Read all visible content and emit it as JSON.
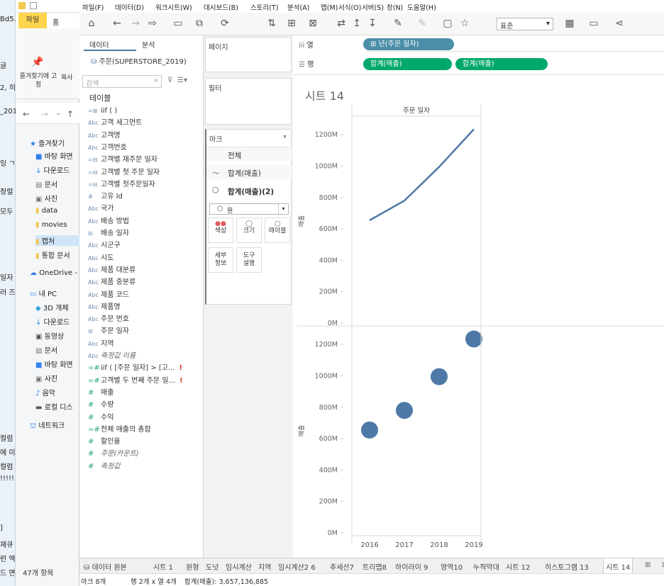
{
  "background_window": {
    "left_strip": [
      "Bd5.n",
      "글",
      "2, 히",
      "_201",
      "잉 ㄱ",
      "정렬",
      "모두",
      "일자",
      "러 즈",
      "컬럼",
      "에 미",
      "컬럼",
      "!!!!!",
      "]",
      "재큐",
      "런 엑",
      "드 면"
    ],
    "explorer": {
      "tabs": [
        "파일",
        "홈"
      ],
      "ribbon_labels": [
        "즐겨찾기에 고정",
        "복사"
      ],
      "quick_access": "즐겨찾기",
      "items": [
        "바탕 화면",
        "다운로드",
        "문서",
        "사진",
        "data",
        "movies",
        "캡처",
        "통합 문서",
        "OneDrive -",
        "내 PC",
        "3D 개체",
        "다운로드",
        "동영상",
        "문서",
        "바탕 화면",
        "사진",
        "음악",
        "로컬 디스",
        "네트워크"
      ],
      "item_count": "47개 항목"
    }
  },
  "menubar": [
    "파일(F)",
    "데이터(D)",
    "워크시트(W)",
    "대시보드(B)",
    "스토리(T)",
    "분석(A)",
    "맵(M)",
    "서식(O)",
    "서버(S)",
    "창(N)",
    "도움말(H)"
  ],
  "toolbar": {
    "standard_label": "표준"
  },
  "data_pane": {
    "tabs": [
      "데이터",
      "분석"
    ],
    "datasource": "주문(SUPERSTORE_2019)",
    "search_placeholder": "검색",
    "section": "테이블",
    "fields": [
      {
        "type": "=⊞",
        "name": "iif ( )",
        "measure": false
      },
      {
        "type": "Abc",
        "name": "고객 세그먼트",
        "measure": false
      },
      {
        "type": "Abc",
        "name": "고객명",
        "measure": false
      },
      {
        "type": "Abc",
        "name": "고객번호",
        "measure": false
      },
      {
        "type": "=⊟",
        "name": "고객별 재주문 일자",
        "measure": false
      },
      {
        "type": "=⊟",
        "name": "고객별 첫 주문 일자",
        "measure": false
      },
      {
        "type": "=⊟",
        "name": "고객별 첫주문일자",
        "measure": false
      },
      {
        "type": "#",
        "name": "고유 Id",
        "measure": false
      },
      {
        "type": "Abc",
        "name": "국가",
        "measure": false
      },
      {
        "type": "Abc",
        "name": "배송 방법",
        "measure": false
      },
      {
        "type": "⊟",
        "name": "배송 일자",
        "measure": false
      },
      {
        "type": "Abc",
        "name": "시군구",
        "measure": false
      },
      {
        "type": "Abc",
        "name": "시도",
        "measure": false
      },
      {
        "type": "Abc",
        "name": "제품 대분류",
        "measure": false
      },
      {
        "type": "Abc",
        "name": "제품 중분류",
        "measure": false
      },
      {
        "type": "Abc",
        "name": "제품 코드",
        "measure": false
      },
      {
        "type": "Abc",
        "name": "제품명",
        "measure": false
      },
      {
        "type": "Abc",
        "name": "주문 번호",
        "measure": false
      },
      {
        "type": "⊟",
        "name": "주문 일자",
        "measure": false
      },
      {
        "type": "Abc",
        "name": "지역",
        "measure": false
      },
      {
        "type": "Abc",
        "name": "측정값 이름",
        "measure": false,
        "italic": true
      },
      {
        "type": "=#",
        "name": "iif ( [주문 일자] > [고...",
        "measure": true,
        "warn": "!"
      },
      {
        "type": "=#",
        "name": "고객별 두 번째 주문 일...",
        "measure": true,
        "warn": "!"
      },
      {
        "type": "#",
        "name": "매출",
        "measure": true
      },
      {
        "type": "#",
        "name": "수량",
        "measure": true
      },
      {
        "type": "#",
        "name": "수익",
        "measure": true
      },
      {
        "type": "=#",
        "name": "전체 매출의 총합",
        "measure": true
      },
      {
        "type": "#",
        "name": "할인율",
        "measure": true
      },
      {
        "type": "#",
        "name": "주문(카운트)",
        "measure": true,
        "italic": true
      },
      {
        "type": "#",
        "name": "측정값",
        "measure": true,
        "italic": true
      }
    ]
  },
  "cards": {
    "pages": "페이지",
    "filters": "필터",
    "marks": "마크",
    "all": "전체",
    "mark1": "합계(매출)",
    "mark2": "합계(매출)(2)",
    "marktype": "원",
    "buttons": [
      "색상",
      "크기",
      "레이블",
      "세부\n정보",
      "도구\n설명"
    ]
  },
  "shelves": {
    "columns_label": "열",
    "rows_label": "행",
    "column_pill": "⊞ 년(주문 일자)",
    "row_pills": [
      "합계(매출)",
      "합계(매출)"
    ]
  },
  "sheet_title": "시트 14",
  "chart_data": [
    {
      "type": "line",
      "header": "주문 일자",
      "ylabel": "매출",
      "categories": [
        "2016",
        "2017",
        "2018",
        "2019"
      ],
      "values": [
        655,
        780,
        995,
        1235
      ],
      "yticks": [
        "0M",
        "200M",
        "400M",
        "600M",
        "800M",
        "1000M",
        "1200M"
      ],
      "ylim": [
        0,
        1300
      ],
      "color": "#4e79a7"
    },
    {
      "type": "scatter",
      "ylabel": "매출",
      "categories": [
        "2016",
        "2017",
        "2018",
        "2019"
      ],
      "values": [
        655,
        780,
        995,
        1235
      ],
      "yticks": [
        "0M",
        "200M",
        "400M",
        "600M",
        "800M",
        "1000M",
        "1200M"
      ],
      "ylim": [
        0,
        1300
      ],
      "color": "#4e79a7"
    }
  ],
  "status": {
    "datasource_tab": "데이터 원본",
    "sheet_tabs": [
      "시트 1",
      "원형",
      "도넛",
      "임시계산",
      "지역",
      "임시계산2 6",
      "추세선7",
      "트리맵8",
      "하이라이 9",
      "영역10",
      "누적막대",
      "시트 12",
      "히스토그램 13",
      "시트 14"
    ],
    "active_tab": "시트 14",
    "marks_info": "마크 8개",
    "rows_cols": "행 2개 x 열 4개",
    "sum_info": "합계(매출): 3,657,136,885"
  },
  "colors": {
    "accent_blue": "#4e79a7",
    "pill_blue": "#4a8ea8",
    "pill_green": "#00a86b",
    "warn": "#d32f2f"
  }
}
